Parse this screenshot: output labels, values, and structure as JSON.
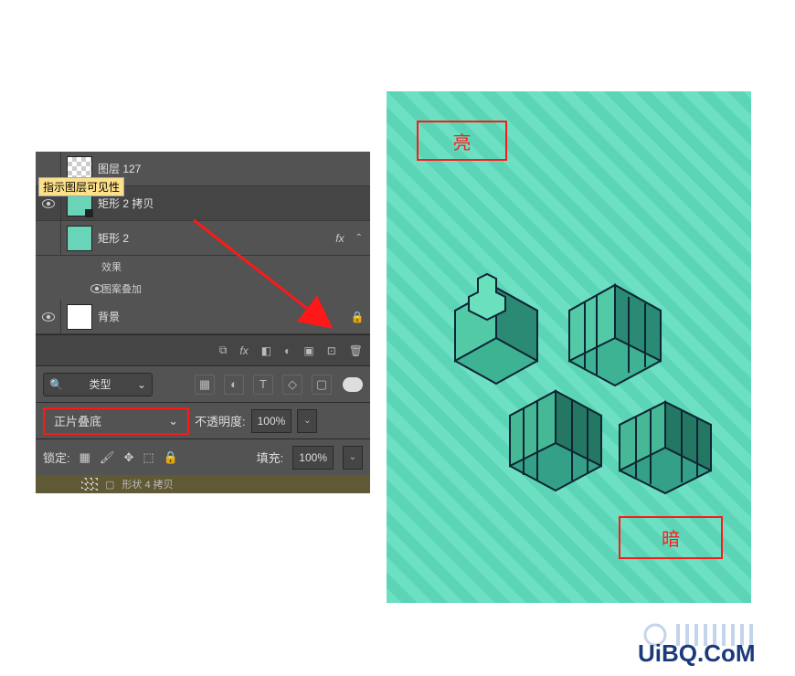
{
  "layers": {
    "tooltip": "指示图层可见性",
    "row0": {
      "name": "图层 127"
    },
    "row1": {
      "name": "矩形 2 拷贝"
    },
    "row2": {
      "name": "矩形 2",
      "fx": "fx"
    },
    "row2_effects": "效果",
    "row2_sub": "图案叠加",
    "row3": {
      "name": "背景"
    },
    "bottom_layer": "形状 4 拷贝"
  },
  "filter": {
    "label": "类型"
  },
  "blend": {
    "mode": "正片叠底",
    "opacity_label": "不透明度:",
    "opacity_value": "100%"
  },
  "lock": {
    "label": "锁定:",
    "fill_label": "填充:",
    "fill_value": "100%"
  },
  "canvas": {
    "bright": "亮",
    "dark": "暗"
  },
  "watermark": "UiBQ.CoM"
}
